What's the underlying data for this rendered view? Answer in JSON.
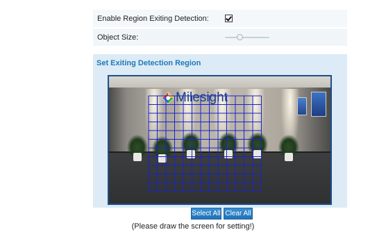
{
  "settings": {
    "enable_label": "Enable Region Exiting Detection:",
    "enable_checked": true,
    "object_size_label": "Object Size:",
    "object_size_level": 0.3
  },
  "region": {
    "title": "Set Exiting Detection Region",
    "logo_text": "Milesight",
    "grid": {
      "columns": 13,
      "rows": 11,
      "color": "#1a24c9"
    }
  },
  "buttons": {
    "select_all": "Select All",
    "clear_all": "Clear All"
  },
  "hint": "(Please draw the screen for setting!)",
  "colors": {
    "accent": "#2179b8",
    "section_bg": "#dcebf5",
    "row_bg": "#f4f8fb",
    "grid": "#1a24c9"
  },
  "icons": {
    "checkbox": "checkbox-checked-icon",
    "logo": "milesight-logo-icon"
  }
}
